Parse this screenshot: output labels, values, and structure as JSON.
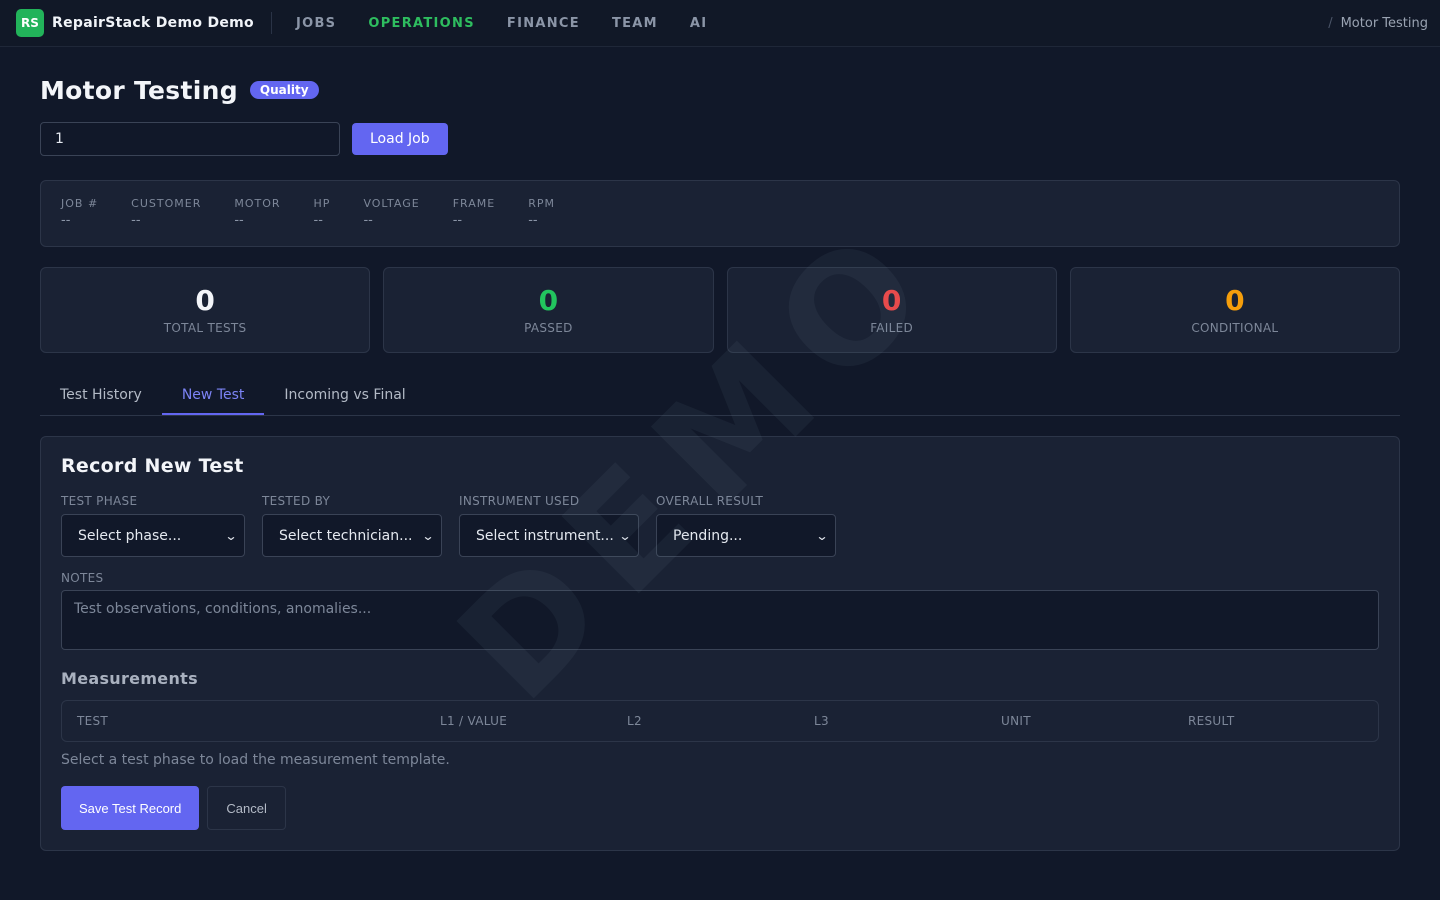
{
  "nav": {
    "logo_text": "RS",
    "brand": "RepairStack Demo Demo",
    "items": [
      {
        "label": "JOBS",
        "active": false
      },
      {
        "label": "OPERATIONS",
        "active": true
      },
      {
        "label": "FINANCE",
        "active": false
      },
      {
        "label": "TEAM",
        "active": false
      },
      {
        "label": "AI",
        "active": false
      }
    ],
    "breadcrumb_sep": "/",
    "breadcrumb": "Motor Testing"
  },
  "watermark": "DEMO",
  "page": {
    "title": "Motor Testing",
    "badge": "Quality"
  },
  "job_loader": {
    "input_value": "1",
    "load_button": "Load Job"
  },
  "job_info": [
    {
      "label": "JOB #",
      "value": "--"
    },
    {
      "label": "CUSTOMER",
      "value": "--"
    },
    {
      "label": "MOTOR",
      "value": "--"
    },
    {
      "label": "HP",
      "value": "--"
    },
    {
      "label": "VOLTAGE",
      "value": "--"
    },
    {
      "label": "FRAME",
      "value": "--"
    },
    {
      "label": "RPM",
      "value": "--"
    }
  ],
  "stats": [
    {
      "value": "0",
      "label": "TOTAL TESTS",
      "color": "#f3f5f9"
    },
    {
      "value": "0",
      "label": "PASSED",
      "color": "#22c55e"
    },
    {
      "value": "0",
      "label": "FAILED",
      "color": "#ef4444"
    },
    {
      "value": "0",
      "label": "CONDITIONAL",
      "color": "#f59e0b"
    }
  ],
  "tabs": [
    {
      "label": "Test History",
      "active": false
    },
    {
      "label": "New Test",
      "active": true
    },
    {
      "label": "Incoming vs Final",
      "active": false
    }
  ],
  "form": {
    "title": "Record New Test",
    "fields": {
      "phase": {
        "label": "TEST PHASE",
        "value": "Select phase..."
      },
      "tester": {
        "label": "TESTED BY",
        "value": "Select technician..."
      },
      "instrument": {
        "label": "INSTRUMENT USED",
        "value": "Select instrument..."
      },
      "result": {
        "label": "OVERALL RESULT",
        "value": "Pending..."
      }
    },
    "notes_label": "NOTES",
    "notes_placeholder": "Test observations, conditions, anomalies...",
    "measurements_title": "Measurements",
    "columns": [
      "TEST",
      "L1 / VALUE",
      "L2",
      "L3",
      "UNIT",
      "RESULT"
    ],
    "hint": "Select a test phase to load the measurement template.",
    "save_button": "Save Test Record",
    "cancel_button": "Cancel"
  },
  "colors": {
    "accent": "#6366f1",
    "active_nav": "#2ebd5f",
    "logo": "#22b35a",
    "background": "#111829",
    "card": "#1a2234"
  }
}
